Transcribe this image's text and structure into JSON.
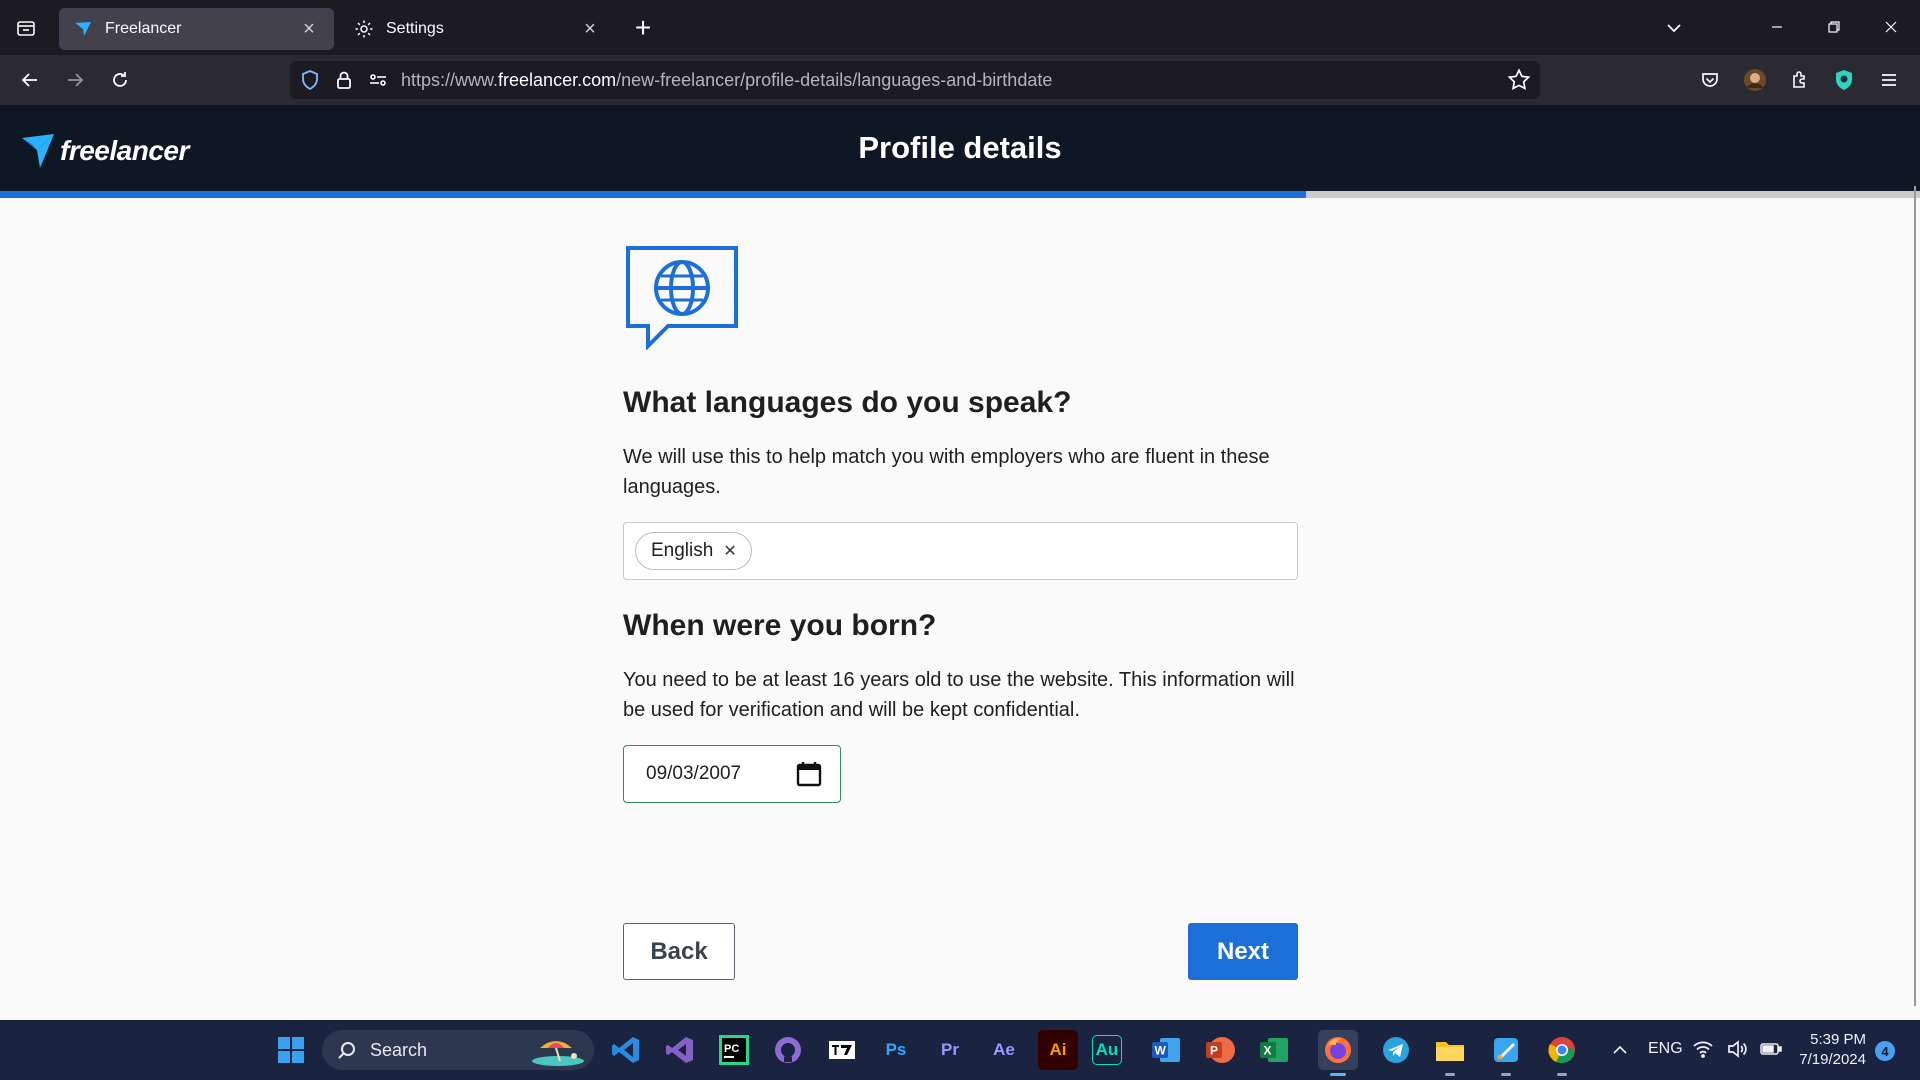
{
  "browser": {
    "tabs": [
      {
        "title": "Freelancer",
        "active": true
      },
      {
        "title": "Settings",
        "active": false
      }
    ],
    "url": {
      "scheme": "https://www.",
      "domain": "freelancer.com",
      "path": "/new-freelancer/profile-details/languages-and-birthdate"
    }
  },
  "site": {
    "logo_text": "freelancer",
    "heading": "Profile details",
    "progress": 0.68,
    "accent_color": "#1c6fd8"
  },
  "languages": {
    "title": "What languages do you speak?",
    "description": "We will use this to help match you with employers who are fluent in these languages.",
    "selected": [
      "English"
    ]
  },
  "birthdate": {
    "title": "When were you born?",
    "description": "You need to be at least 16 years old to use the website. This information will be used for verification and will be kept confidential.",
    "value": "09/03/2007"
  },
  "actions": {
    "back_label": "Back",
    "next_label": "Next"
  },
  "taskbar": {
    "search_label": "Search",
    "apps": [
      "VS Code",
      "Visual Studio",
      "PyCharm",
      "GitHub Desktop",
      "Typora",
      "Photoshop",
      "Premiere Pro",
      "After Effects",
      "Illustrator",
      "Audition",
      "Word",
      "PowerPoint",
      "Excel",
      "Firefox",
      "Telegram",
      "File Explorer",
      "Paint",
      "Chrome"
    ],
    "app_labels": {
      "pycharm": "PC",
      "photoshop": "Ps",
      "premiere": "Pr",
      "after_effects": "Ae",
      "illustrator": "Ai",
      "audition": "Au",
      "word": "W",
      "powerpoint": "P",
      "excel": "X"
    },
    "tray": {
      "language": "ENG",
      "time": "5:39 PM",
      "date": "7/19/2024",
      "notifications": "4"
    }
  }
}
